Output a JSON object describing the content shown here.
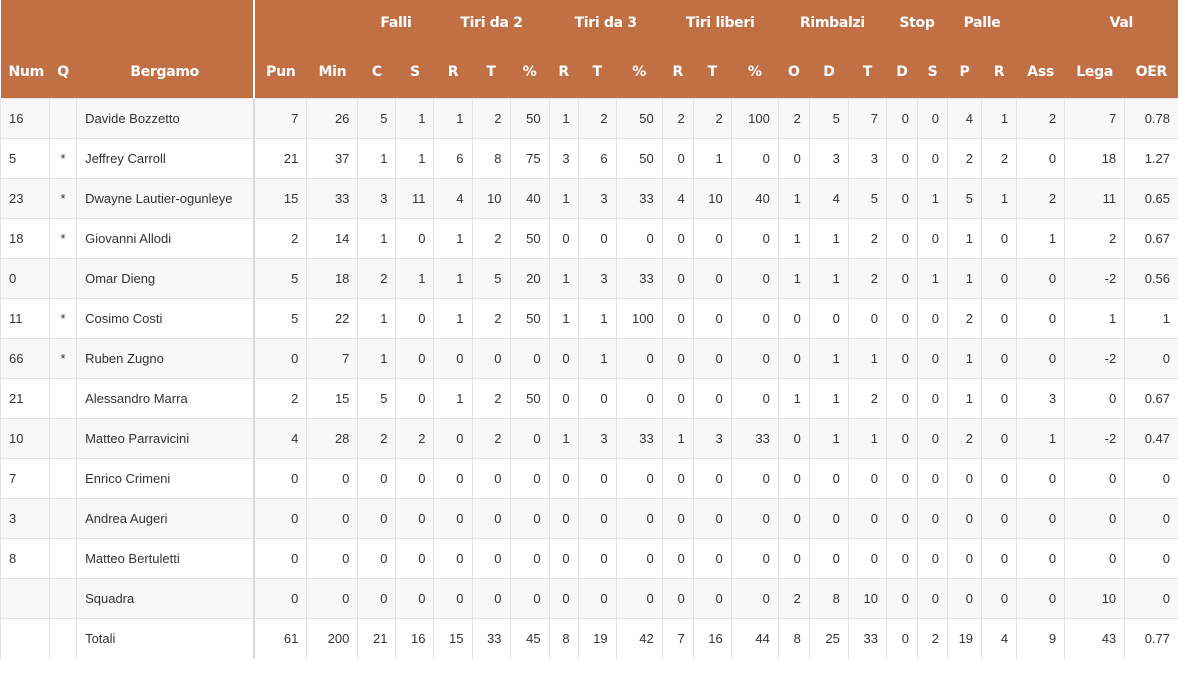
{
  "groups": [
    {
      "label": "",
      "span": 3
    },
    {
      "label": "",
      "span": 2
    },
    {
      "label": "Falli",
      "span": 2
    },
    {
      "label": "Tiri da 2",
      "span": 3
    },
    {
      "label": "Tiri da 3",
      "span": 3
    },
    {
      "label": "Tiri liberi",
      "span": 3
    },
    {
      "label": "Rimbalzi",
      "span": 3
    },
    {
      "label": "Stop",
      "span": 2
    },
    {
      "label": "Palle",
      "span": 2
    },
    {
      "label": "",
      "span": 1
    },
    {
      "label": "Val",
      "span": 2
    }
  ],
  "columns": [
    "Num",
    "Q",
    "Bergamo",
    "Pun",
    "Min",
    "C",
    "S",
    "R",
    "T",
    "%",
    "R",
    "T",
    "%",
    "R",
    "T",
    "%",
    "O",
    "D",
    "T",
    "D",
    "S",
    "P",
    "R",
    "Ass",
    "Lega",
    "OER"
  ],
  "rows": [
    [
      "16",
      "",
      "Davide Bozzetto",
      "7",
      "26",
      "5",
      "1",
      "1",
      "2",
      "50",
      "1",
      "2",
      "50",
      "2",
      "2",
      "100",
      "2",
      "5",
      "7",
      "0",
      "0",
      "4",
      "1",
      "2",
      "7",
      "0.78"
    ],
    [
      "5",
      "*",
      "Jeffrey Carroll",
      "21",
      "37",
      "1",
      "1",
      "6",
      "8",
      "75",
      "3",
      "6",
      "50",
      "0",
      "1",
      "0",
      "0",
      "3",
      "3",
      "0",
      "0",
      "2",
      "2",
      "0",
      "18",
      "1.27"
    ],
    [
      "23",
      "*",
      "Dwayne Lautier-ogunleye",
      "15",
      "33",
      "3",
      "11",
      "4",
      "10",
      "40",
      "1",
      "3",
      "33",
      "4",
      "10",
      "40",
      "1",
      "4",
      "5",
      "0",
      "1",
      "5",
      "1",
      "2",
      "11",
      "0.65"
    ],
    [
      "18",
      "*",
      "Giovanni Allodi",
      "2",
      "14",
      "1",
      "0",
      "1",
      "2",
      "50",
      "0",
      "0",
      "0",
      "0",
      "0",
      "0",
      "1",
      "1",
      "2",
      "0",
      "0",
      "1",
      "0",
      "1",
      "2",
      "0.67"
    ],
    [
      "0",
      "",
      "Omar Dieng",
      "5",
      "18",
      "2",
      "1",
      "1",
      "5",
      "20",
      "1",
      "3",
      "33",
      "0",
      "0",
      "0",
      "1",
      "1",
      "2",
      "0",
      "1",
      "1",
      "0",
      "0",
      "-2",
      "0.56"
    ],
    [
      "11",
      "*",
      "Cosimo Costi",
      "5",
      "22",
      "1",
      "0",
      "1",
      "2",
      "50",
      "1",
      "1",
      "100",
      "0",
      "0",
      "0",
      "0",
      "0",
      "0",
      "0",
      "0",
      "2",
      "0",
      "0",
      "1",
      "1"
    ],
    [
      "66",
      "*",
      "Ruben Zugno",
      "0",
      "7",
      "1",
      "0",
      "0",
      "0",
      "0",
      "0",
      "1",
      "0",
      "0",
      "0",
      "0",
      "0",
      "1",
      "1",
      "0",
      "0",
      "1",
      "0",
      "0",
      "-2",
      "0"
    ],
    [
      "21",
      "",
      "Alessandro Marra",
      "2",
      "15",
      "5",
      "0",
      "1",
      "2",
      "50",
      "0",
      "0",
      "0",
      "0",
      "0",
      "0",
      "1",
      "1",
      "2",
      "0",
      "0",
      "1",
      "0",
      "3",
      "0",
      "0.67"
    ],
    [
      "10",
      "",
      "Matteo Parravicini",
      "4",
      "28",
      "2",
      "2",
      "0",
      "2",
      "0",
      "1",
      "3",
      "33",
      "1",
      "3",
      "33",
      "0",
      "1",
      "1",
      "0",
      "0",
      "2",
      "0",
      "1",
      "-2",
      "0.47"
    ],
    [
      "7",
      "",
      "Enrico Crimeni",
      "0",
      "0",
      "0",
      "0",
      "0",
      "0",
      "0",
      "0",
      "0",
      "0",
      "0",
      "0",
      "0",
      "0",
      "0",
      "0",
      "0",
      "0",
      "0",
      "0",
      "0",
      "0",
      "0"
    ],
    [
      "3",
      "",
      "Andrea Augeri",
      "0",
      "0",
      "0",
      "0",
      "0",
      "0",
      "0",
      "0",
      "0",
      "0",
      "0",
      "0",
      "0",
      "0",
      "0",
      "0",
      "0",
      "0",
      "0",
      "0",
      "0",
      "0",
      "0"
    ],
    [
      "8",
      "",
      "Matteo Bertuletti",
      "0",
      "0",
      "0",
      "0",
      "0",
      "0",
      "0",
      "0",
      "0",
      "0",
      "0",
      "0",
      "0",
      "0",
      "0",
      "0",
      "0",
      "0",
      "0",
      "0",
      "0",
      "0",
      "0"
    ],
    [
      "",
      "",
      "Squadra",
      "0",
      "0",
      "0",
      "0",
      "0",
      "0",
      "0",
      "0",
      "0",
      "0",
      "0",
      "0",
      "0",
      "2",
      "8",
      "10",
      "0",
      "0",
      "0",
      "0",
      "0",
      "10",
      "0"
    ],
    [
      "",
      "",
      "Totali",
      "61",
      "200",
      "21",
      "16",
      "15",
      "33",
      "45",
      "8",
      "19",
      "42",
      "7",
      "16",
      "44",
      "8",
      "25",
      "33",
      "0",
      "2",
      "19",
      "4",
      "9",
      "43",
      "0.77"
    ]
  ],
  "colors": {
    "header_bg": "#c17045",
    "header_text": "#ffffff"
  }
}
